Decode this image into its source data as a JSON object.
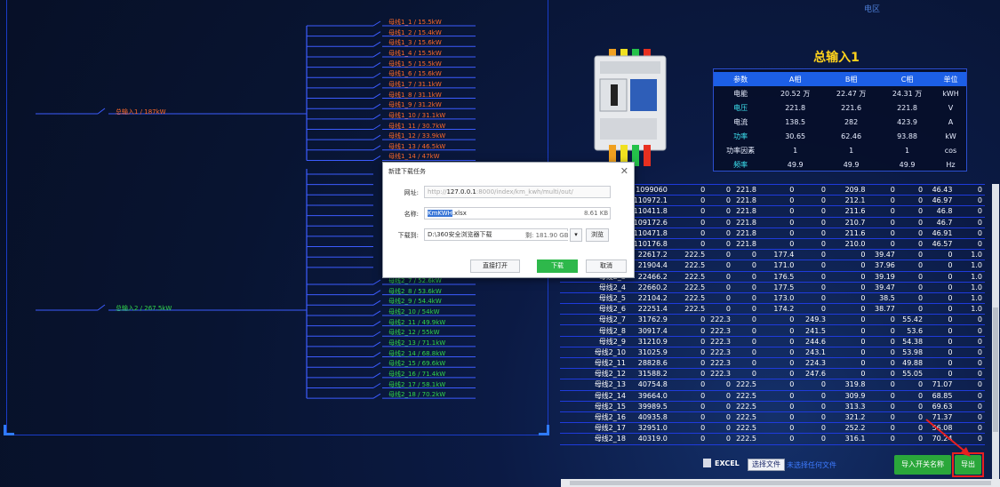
{
  "region_label": "电区",
  "diagram": {
    "main1": {
      "label": "总输入1 / 187kW",
      "color": "#ff6a2a"
    },
    "main2": {
      "label": "总输入2 / 267.5kW",
      "color": "#31d44a"
    },
    "branches1": [
      {
        "label": "母线1_1 / 15.5kW"
      },
      {
        "label": "母线1_2 / 15.4kW"
      },
      {
        "label": "母线1_3 / 15.6kW"
      },
      {
        "label": "母线1_4 / 15.5kW"
      },
      {
        "label": "母线1_5 / 15.5kW"
      },
      {
        "label": "母线1_6 / 15.6kW"
      },
      {
        "label": "母线1_7 / 31.1kW"
      },
      {
        "label": "母线1_8 / 31.1kW"
      },
      {
        "label": "母线1_9 / 31.2kW"
      },
      {
        "label": "母线1_10 / 31.1kW"
      },
      {
        "label": "母线1_11 / 30.7kW"
      },
      {
        "label": "母线1_12 / 33.9kW"
      },
      {
        "label": "母线1_13 / 46.5kW"
      },
      {
        "label": "母线1_14 / 47kW"
      }
    ],
    "branches2": [
      {
        "label": "母线2_7 / 52.6kW"
      },
      {
        "label": "母线2_8 / 53.6kW"
      },
      {
        "label": "母线2_9 / 54.4kW"
      },
      {
        "label": "母线2_10 / 54kW"
      },
      {
        "label": "母线2_11 / 49.9kW"
      },
      {
        "label": "母线2_12 / 55kW"
      },
      {
        "label": "母线2_13 / 71.1kW"
      },
      {
        "label": "母线2_14 / 68.8kW"
      },
      {
        "label": "母线2_15 / 69.6kW"
      },
      {
        "label": "母线2_16 / 71.4kW"
      },
      {
        "label": "母线2_17 / 58.1kW"
      },
      {
        "label": "母线2_18 / 70.2kW"
      }
    ]
  },
  "params": {
    "title": "总输入1",
    "headers": [
      "参数",
      "A相",
      "B相",
      "C相",
      "单位"
    ],
    "rows": [
      {
        "name": "电能",
        "a": "20.52 万",
        "b": "22.47 万",
        "c": "24.31 万",
        "unit": "kWH",
        "style": "white"
      },
      {
        "name": "电压",
        "a": "221.8",
        "b": "221.6",
        "c": "221.8",
        "unit": "V",
        "style": "cyan"
      },
      {
        "name": "电流",
        "a": "138.5",
        "b": "282",
        "c": "423.9",
        "unit": "A",
        "style": "white"
      },
      {
        "name": "功率",
        "a": "30.65",
        "b": "62.46",
        "c": "93.88",
        "unit": "kW",
        "style": "cyan"
      },
      {
        "name": "功率因素",
        "a": "1",
        "b": "1",
        "c": "1",
        "unit": "cos",
        "style": "white"
      },
      {
        "name": "频率",
        "a": "49.9",
        "b": "49.9",
        "c": "49.9",
        "unit": "Hz",
        "style": "cyan"
      }
    ]
  },
  "table_rows": [
    [
      "",
      "1099060",
      "0",
      "0",
      "221.8",
      "0",
      "0",
      "209.8",
      "0",
      "0",
      "46.43",
      "0"
    ],
    [
      "",
      "110972.1",
      "0",
      "0",
      "221.8",
      "0",
      "0",
      "212.1",
      "0",
      "0",
      "46.97",
      "0"
    ],
    [
      "",
      "110411.8",
      "0",
      "0",
      "221.8",
      "0",
      "0",
      "211.6",
      "0",
      "0",
      "46.8",
      "0"
    ],
    [
      "",
      "109172.6",
      "0",
      "0",
      "221.8",
      "0",
      "0",
      "210.7",
      "0",
      "0",
      "46.7",
      "0"
    ],
    [
      "",
      "110471.8",
      "0",
      "0",
      "221.8",
      "0",
      "0",
      "211.6",
      "0",
      "0",
      "46.91",
      "0"
    ],
    [
      "",
      "110176.8",
      "0",
      "0",
      "221.8",
      "0",
      "0",
      "210.0",
      "0",
      "0",
      "46.57",
      "0"
    ],
    [
      "",
      "22617.2",
      "222.5",
      "0",
      "0",
      "177.4",
      "0",
      "0",
      "39.47",
      "0",
      "0",
      "1.0"
    ],
    [
      "",
      "21904.4",
      "222.5",
      "0",
      "0",
      "171.0",
      "0",
      "0",
      "37.96",
      "0",
      "0",
      "1.0"
    ],
    [
      "母线2_3",
      "22466.2",
      "222.5",
      "0",
      "0",
      "176.5",
      "0",
      "0",
      "39.19",
      "0",
      "0",
      "1.0"
    ],
    [
      "母线2_4",
      "22660.2",
      "222.5",
      "0",
      "0",
      "177.5",
      "0",
      "0",
      "39.47",
      "0",
      "0",
      "1.0"
    ],
    [
      "母线2_5",
      "22104.2",
      "222.5",
      "0",
      "0",
      "173.0",
      "0",
      "0",
      "38.5",
      "0",
      "0",
      "1.0"
    ],
    [
      "母线2_6",
      "22251.4",
      "222.5",
      "0",
      "0",
      "174.2",
      "0",
      "0",
      "38.77",
      "0",
      "0",
      "1.0"
    ],
    [
      "母线2_7",
      "31762.9",
      "0",
      "222.3",
      "0",
      "0",
      "249.3",
      "0",
      "0",
      "55.42",
      "0",
      "0"
    ],
    [
      "母线2_8",
      "30917.4",
      "0",
      "222.3",
      "0",
      "0",
      "241.5",
      "0",
      "0",
      "53.6",
      "0",
      "0"
    ],
    [
      "母线2_9",
      "31210.9",
      "0",
      "222.3",
      "0",
      "0",
      "244.6",
      "0",
      "0",
      "54.38",
      "0",
      "0"
    ],
    [
      "母线2_10",
      "31025.9",
      "0",
      "222.3",
      "0",
      "0",
      "243.1",
      "0",
      "0",
      "53.98",
      "0",
      "0"
    ],
    [
      "母线2_11",
      "28828.6",
      "0",
      "222.3",
      "0",
      "0",
      "224.3",
      "0",
      "0",
      "49.88",
      "0",
      "0"
    ],
    [
      "母线2_12",
      "31588.2",
      "0",
      "222.3",
      "0",
      "0",
      "247.6",
      "0",
      "0",
      "55.05",
      "0",
      "0"
    ],
    [
      "母线2_13",
      "40754.8",
      "0",
      "0",
      "222.5",
      "0",
      "0",
      "319.8",
      "0",
      "0",
      "71.07",
      "0"
    ],
    [
      "母线2_14",
      "39664.0",
      "0",
      "0",
      "222.5",
      "0",
      "0",
      "309.9",
      "0",
      "0",
      "68.85",
      "0"
    ],
    [
      "母线2_15",
      "39989.5",
      "0",
      "0",
      "222.5",
      "0",
      "0",
      "313.3",
      "0",
      "0",
      "69.63",
      "0"
    ],
    [
      "母线2_16",
      "40935.8",
      "0",
      "0",
      "222.5",
      "0",
      "0",
      "321.2",
      "0",
      "0",
      "71.37",
      "0"
    ],
    [
      "母线2_17",
      "32951.0",
      "0",
      "0",
      "222.5",
      "0",
      "0",
      "252.2",
      "0",
      "0",
      "56.08",
      "0"
    ],
    [
      "母线2_18",
      "40319.0",
      "0",
      "0",
      "222.5",
      "0",
      "0",
      "316.1",
      "0",
      "0",
      "70.24",
      "0"
    ]
  ],
  "toolbar": {
    "excel_label": "EXCEL",
    "file_button": "选择文件",
    "file_hint": "未选择任何文件",
    "import_button": "导入开关名称",
    "export_button": "导出"
  },
  "dialog": {
    "title": "新建下载任务",
    "url_label": "网址:",
    "url_prefix": "http://",
    "url_host": "127.0.0.1",
    "url_rest": ":8000/index/km_kwh/multi/out/",
    "name_label": "名称:",
    "name_selected": "KmKWH",
    "name_ext": ".xlsx",
    "name_size": "8.61 KB",
    "dest_label": "下载到:",
    "dest_path": "D:\\360安全浏览器下载",
    "dest_free": "剩: 181.90 GB",
    "browse_button": "浏览",
    "open_button": "直接打开",
    "download_button": "下载",
    "cancel_button": "取消"
  }
}
